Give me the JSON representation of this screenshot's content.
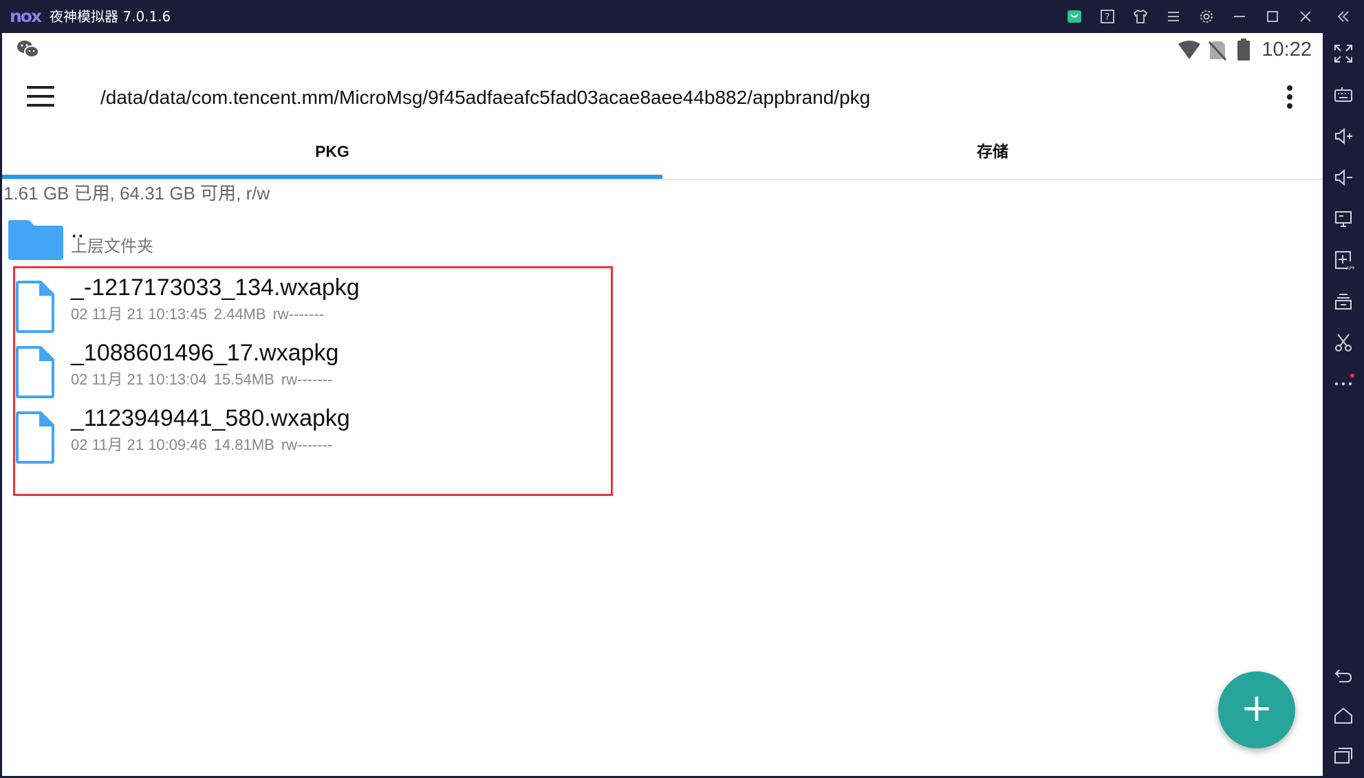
{
  "window": {
    "logo": "nox",
    "title": "夜神模拟器 7.0.1.6",
    "controls": [
      "store-icon",
      "help-icon",
      "skin-icon",
      "menu-lines-icon",
      "settings-icon",
      "minimize-icon",
      "maximize-icon",
      "close-icon",
      "collapse-icon"
    ]
  },
  "status_bar": {
    "time": "10:22",
    "notification_icon": "wechat-icon",
    "indicators": [
      "wifi-icon",
      "no-sim-icon",
      "battery-icon"
    ]
  },
  "app_bar": {
    "path": "/data/data/com.tencent.mm/MicroMsg/9f45adfaeafc5fad03acae8aee44b882/appbrand/pkg"
  },
  "tabs": [
    {
      "label": "PKG",
      "active": true
    },
    {
      "label": "存储",
      "active": false
    }
  ],
  "storage_info": "1.61 GB 已用, 64.31 GB 可用, r/w",
  "parent_folder": {
    "name": "..",
    "label": "上层文件夹"
  },
  "files": [
    {
      "name": "_-1217173033_134.wxapkg",
      "date": "02 11月 21 10:13:45",
      "size": "2.44MB",
      "perms": "rw-------"
    },
    {
      "name": "_1088601496_17.wxapkg",
      "date": "02 11月 21 10:13:04",
      "size": "15.54MB",
      "perms": "rw-------"
    },
    {
      "name": "_1123949441_580.wxapkg",
      "date": "02 11月 21 10:09:46",
      "size": "14.81MB",
      "perms": "rw-------"
    }
  ],
  "fab_label": "+",
  "sidebar_tools": [
    "fullscreen-icon",
    "keyboard-icon",
    "volume-up-icon",
    "volume-down-icon",
    "screen-icon",
    "apk-install-icon",
    "multi-instance-icon",
    "scissors-icon",
    "more-icon",
    "back-icon",
    "home-icon",
    "recent-apps-icon"
  ],
  "colors": {
    "frame": "#1b1c38",
    "tab_indicator": "#2196f3",
    "folder": "#42a5f5",
    "fab": "#26a69a",
    "highlight": "#e8343e"
  }
}
